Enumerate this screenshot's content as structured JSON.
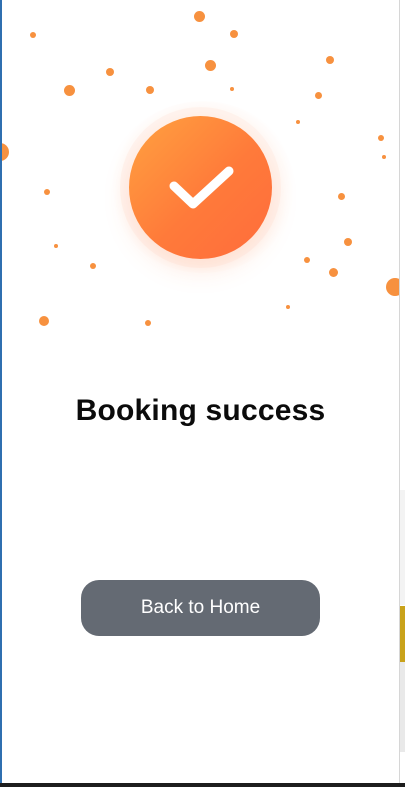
{
  "screen": {
    "title": "Booking success",
    "primary_button_label": "Back to Home"
  },
  "icons": {
    "badge": "check-icon"
  },
  "colors": {
    "badge_gradient_start": "#ffa240",
    "badge_gradient_end": "#ff6c3c",
    "confetti": "#f7913f",
    "button_bg": "#646a73",
    "button_text": "#ffffff",
    "title_text": "#0b0b0b"
  }
}
